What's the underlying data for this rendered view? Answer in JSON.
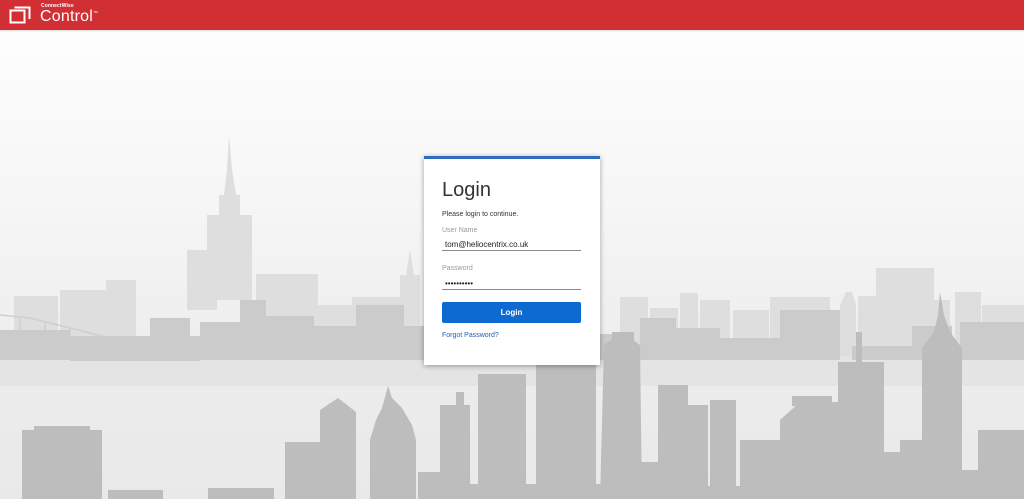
{
  "header": {
    "brand_small": "ConnectWise",
    "brand_name": "Control",
    "brand_tm": "™",
    "bar_color": "#d12f33",
    "logo_icon": "connectwise-control-logo-icon"
  },
  "login": {
    "title": "Login",
    "subtitle": "Please login to continue.",
    "username_label": "User Name",
    "username_value": "tom@heliocentrix.co.uk",
    "password_label": "Password",
    "password_value": "••••••••••",
    "button_label": "Login",
    "forgot_link": "Forgot Password?",
    "accent_color": "#0d6ad1"
  },
  "background": {
    "image": "city-skyline-silhouette"
  }
}
